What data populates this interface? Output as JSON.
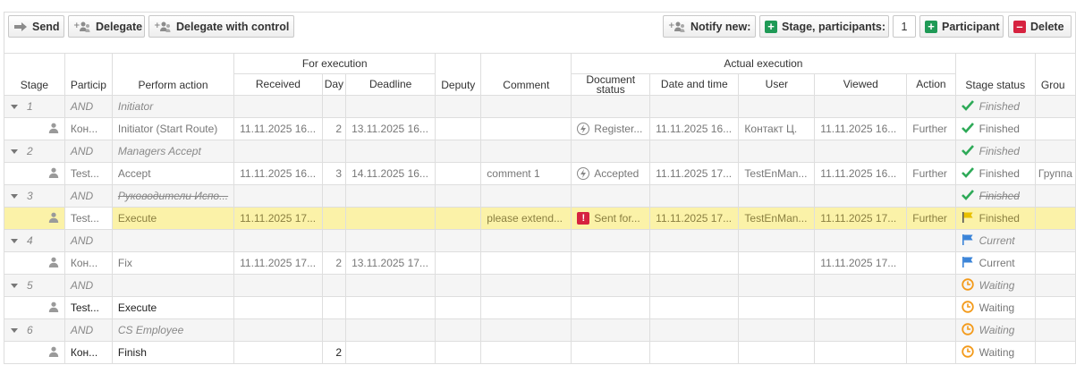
{
  "toolbar": {
    "send": "Send",
    "delegate": "Delegate",
    "delegate_control": "Delegate with control",
    "notify_new": "Notify new:",
    "stage_participants": "Stage, participants:",
    "stage_count": "1",
    "participant": "Participant",
    "delete": "Delete"
  },
  "columns": {
    "stage": "Stage",
    "participant": "Particip",
    "perform_action": "Perform action",
    "for_execution": "For execution",
    "received": "Received",
    "days": "Day",
    "deadline": "Deadline",
    "deputy": "Deputy",
    "comment": "Comment",
    "actual_execution": "Actual execution",
    "document_status": "Document status",
    "date_time": "Date and time",
    "user": "User",
    "viewed": "Viewed",
    "action": "Action",
    "stage_status": "Stage status",
    "group": "Grou"
  },
  "rows": {
    "r1g": {
      "stage": "1",
      "participant": "AND",
      "action": "Initiator",
      "status": "Finished"
    },
    "r1p": {
      "participant": "Кон...",
      "action": "Initiator (Start Route)",
      "received": "11.11.2025 16...",
      "days": "2",
      "deadline": "13.11.2025 16...",
      "doc_status": "Register...",
      "date_time": "11.11.2025 16...",
      "user": "Контакт Ц.",
      "viewed": "11.11.2025 16...",
      "act": "Further",
      "status": "Finished"
    },
    "r2g": {
      "stage": "2",
      "participant": "AND",
      "action": "Managers Accept",
      "status": "Finished"
    },
    "r2p": {
      "participant": "Test...",
      "action": "Accept",
      "received": "11.11.2025 16...",
      "days": "3",
      "deadline": "14.11.2025 16...",
      "comment": "comment 1",
      "doc_status": "Accepted",
      "date_time": "11.11.2025 17...",
      "user": "TestEnMan...",
      "viewed": "11.11.2025 16...",
      "act": "Further",
      "status": "Finished",
      "group": "Группа"
    },
    "r3g": {
      "stage": "3",
      "participant": "AND",
      "action": "Руководители Испо...",
      "status": "Finished"
    },
    "r3p": {
      "participant": "Test...",
      "action": "Execute",
      "received": "11.11.2025 17...",
      "comment": "please extend...",
      "doc_status": "Sent for...",
      "date_time": "11.11.2025 17...",
      "user": "TestEnMan...",
      "viewed": "11.11.2025 17...",
      "act": "Further",
      "status": "Finished"
    },
    "r4g": {
      "stage": "4",
      "participant": "AND",
      "status": "Current"
    },
    "r4p": {
      "participant": "Кон...",
      "action": "Fix",
      "received": "11.11.2025 17...",
      "days": "2",
      "deadline": "13.11.2025 17...",
      "viewed": "11.11.2025 17...",
      "status": "Current"
    },
    "r5g": {
      "stage": "5",
      "participant": "AND",
      "status": "Waiting"
    },
    "r5p": {
      "participant": "Test...",
      "action": "Execute",
      "status": "Waiting"
    },
    "r6g": {
      "stage": "6",
      "participant": "AND",
      "action": "CS Employee",
      "status": "Waiting"
    },
    "r6p": {
      "participant": "Кон...",
      "action": "Finish",
      "days": "2",
      "status": "Waiting"
    }
  },
  "colors": {
    "finished": "#2eaa58",
    "current": "#3b84d8",
    "waiting": "#f39a1a",
    "highlight": "#fbf2a8",
    "flag": "#e8c000"
  },
  "icons": {
    "send": "arrow-right-icon",
    "delegate": "people-plus-icon",
    "participant": "plus-icon",
    "delete": "minus-icon",
    "finished": "checkmark-icon",
    "current": "flag-icon",
    "waiting": "clock-icon"
  }
}
